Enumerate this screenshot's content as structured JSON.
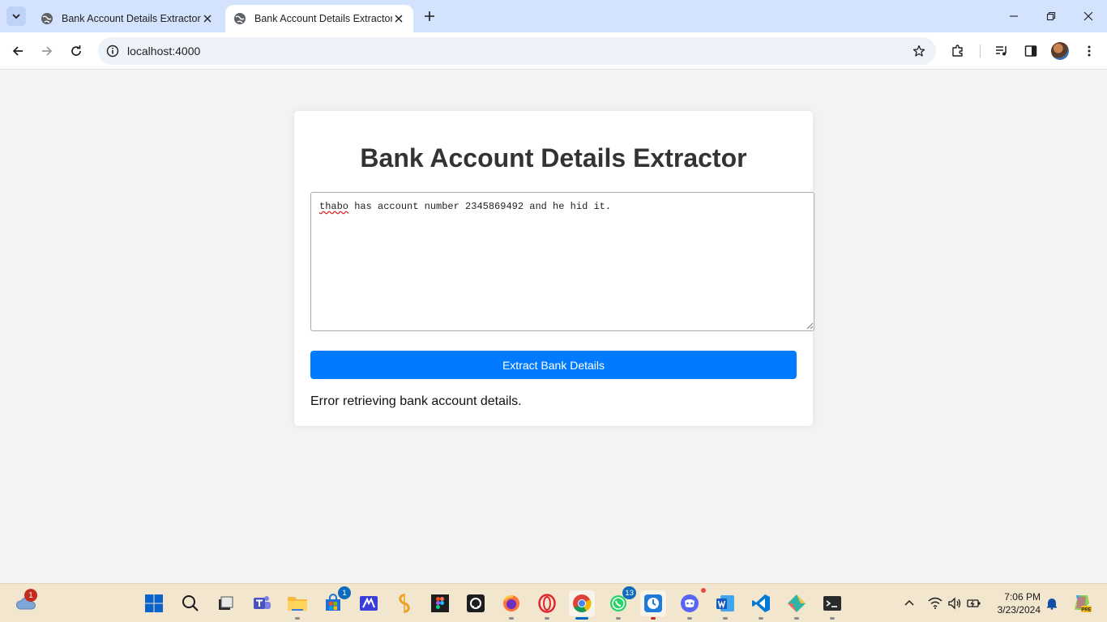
{
  "browser": {
    "tabs": [
      {
        "title": "Bank Account Details Extractor",
        "active": false
      },
      {
        "title": "Bank Account Details Extractor",
        "active": true
      }
    ],
    "address": "localhost:4000"
  },
  "page": {
    "heading": "Bank Account Details Extractor",
    "input_text_word1": "thabo",
    "input_text_rest": " has account number 2345869492 and he hid it.",
    "button_label": "Extract Bank Details",
    "result_text": "Error retrieving bank account details.",
    "accent_color": "#007bff"
  },
  "taskbar": {
    "weather_badge": "1",
    "apps": [
      {
        "name": "windows-start",
        "badge": null
      },
      {
        "name": "search",
        "badge": null
      },
      {
        "name": "task-view",
        "badge": null
      },
      {
        "name": "teams",
        "badge": null
      },
      {
        "name": "file-explorer",
        "badge": null
      },
      {
        "name": "microsoft-store",
        "badge": "1"
      },
      {
        "name": "app-blue",
        "badge": null
      },
      {
        "name": "app-orange",
        "badge": null
      },
      {
        "name": "figma",
        "badge": null
      },
      {
        "name": "github",
        "badge": null
      },
      {
        "name": "firefox",
        "badge": null
      },
      {
        "name": "opera",
        "badge": null
      },
      {
        "name": "chrome",
        "badge": null
      },
      {
        "name": "whatsapp",
        "badge": "13"
      },
      {
        "name": "app-clock",
        "badge": null
      },
      {
        "name": "discord",
        "badge": null
      },
      {
        "name": "word",
        "badge": null
      },
      {
        "name": "vscode",
        "badge": null
      },
      {
        "name": "app-git",
        "badge": null
      },
      {
        "name": "terminal",
        "badge": null
      }
    ],
    "time": "7:06 PM",
    "date": "3/23/2024"
  }
}
